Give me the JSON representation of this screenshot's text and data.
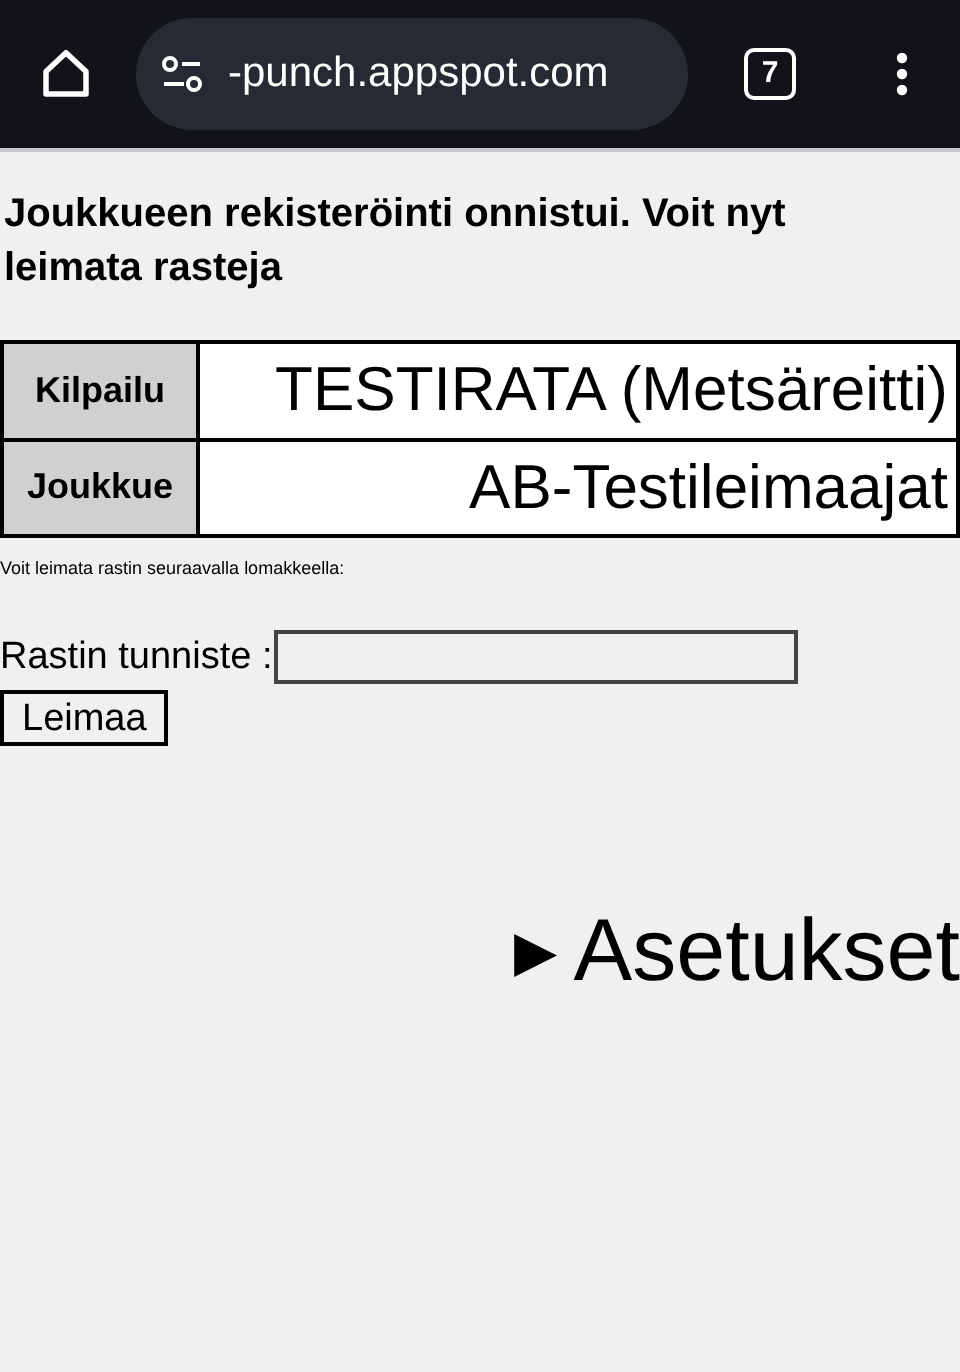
{
  "browser_bar": {
    "url": "-punch.appspot.com",
    "tab_count": "7"
  },
  "heading": "Joukkueen rekisteröinti onnistui. Voit nyt leimata rasteja",
  "info_table": {
    "rows": [
      {
        "label": "Kilpailu",
        "value": "TESTIRATA (Metsäreitti)"
      },
      {
        "label": "Joukkue",
        "value": "AB-Testileimaajat"
      }
    ]
  },
  "note": "Voit leimata rastin seuraavalla lomakkeella:",
  "form": {
    "label": "Rastin tunniste :",
    "button": "Leimaa"
  },
  "settings": {
    "marker": "▶",
    "label": "Asetukset",
    "expanded": false
  }
}
